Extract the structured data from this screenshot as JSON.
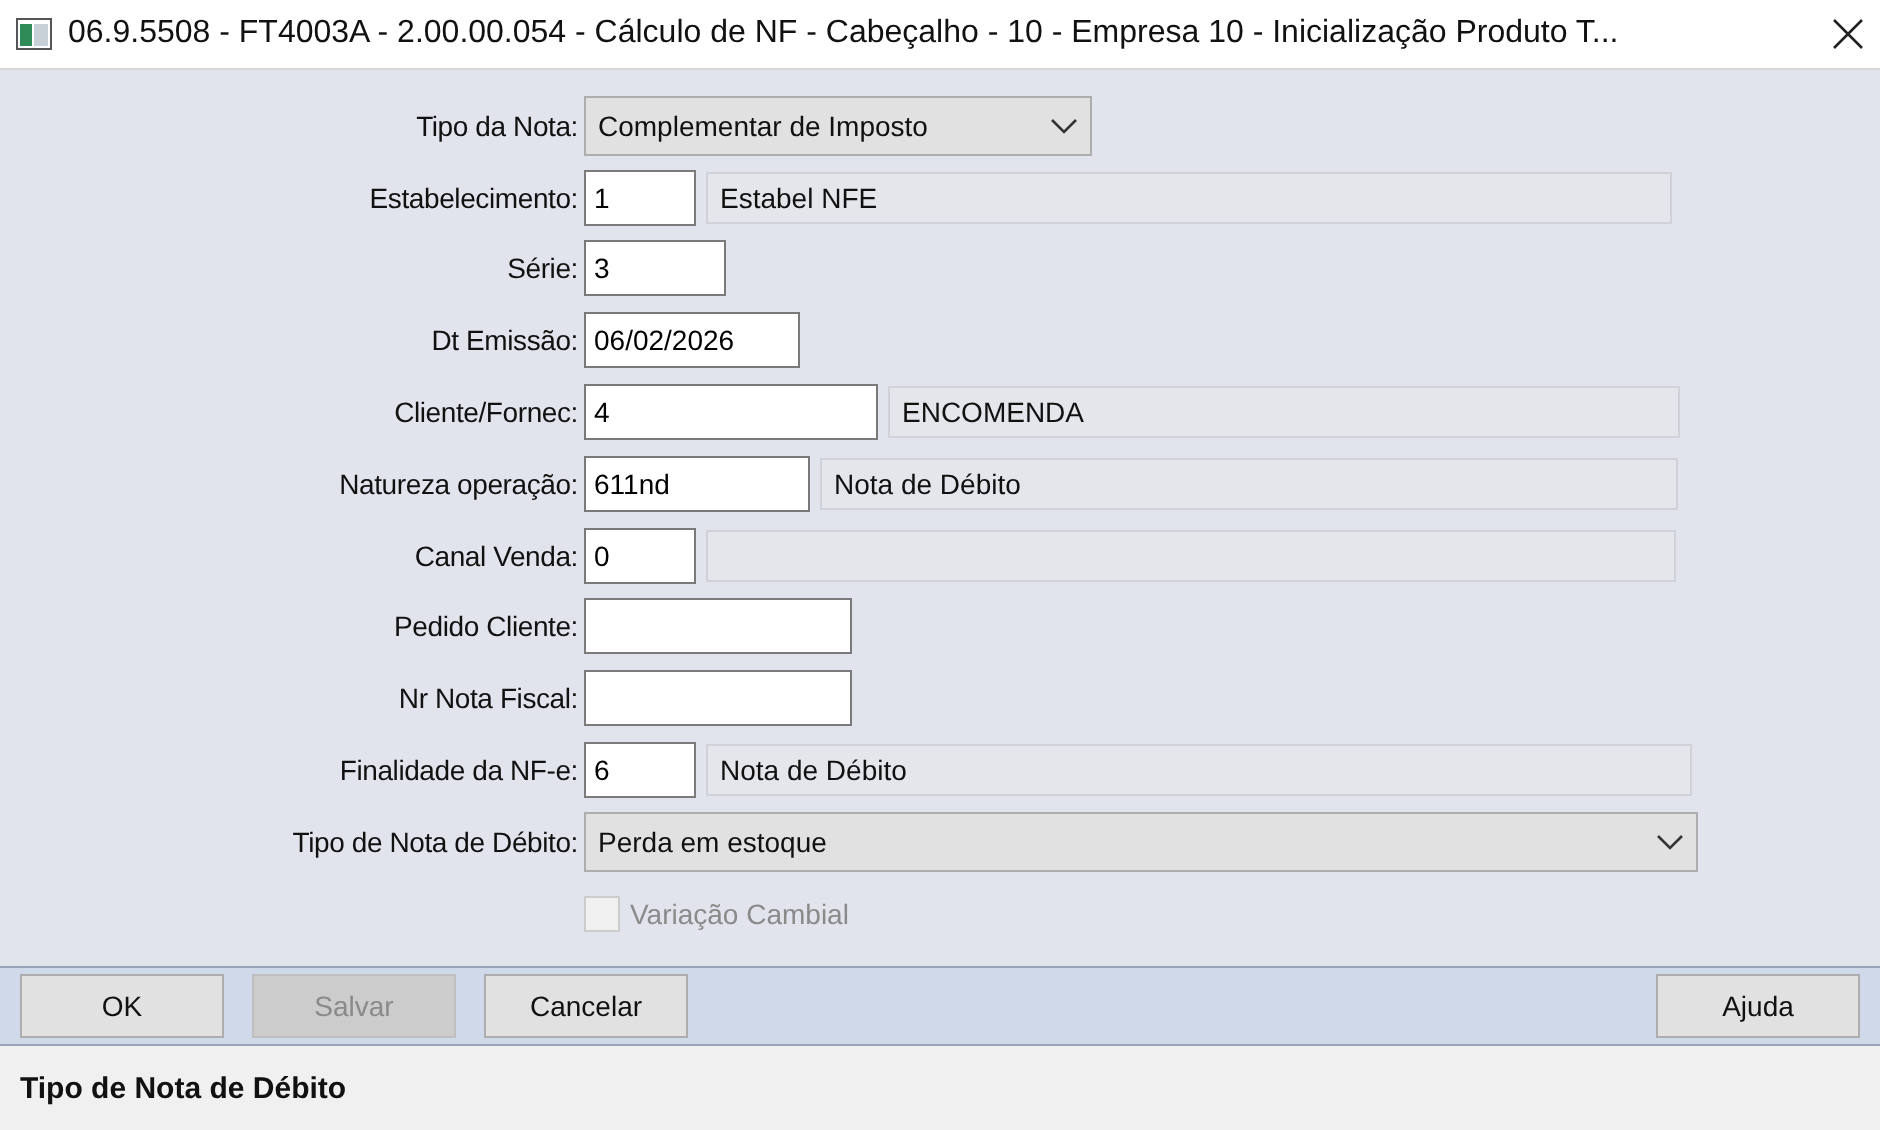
{
  "window": {
    "title": "06.9.5508 - FT4003A - 2.00.00.054 - Cálculo de NF - Cabeçalho - 10 - Empresa 10 - Inicialização Produto T..."
  },
  "form": [
    {
      "kind": "select",
      "label": "Tipo da Nota:",
      "value": "Complementar de Imposto"
    },
    {
      "kind": "field",
      "label": "Estabelecimento:",
      "value": "1",
      "description": "Estabel NFE"
    },
    {
      "kind": "field",
      "label": "Série:",
      "value": "3"
    },
    {
      "kind": "field",
      "label": "Dt Emissão:",
      "value": "06/02/2026"
    },
    {
      "kind": "field",
      "label": "Cliente/Fornec:",
      "value": "4",
      "description": "ENCOMENDA"
    },
    {
      "kind": "field",
      "label": "Natureza operação:",
      "value": "611nd",
      "description": "Nota de Débito"
    },
    {
      "kind": "lookup",
      "label": "Canal Venda:",
      "value": "0"
    },
    {
      "kind": "field",
      "label": "Pedido Cliente:"
    },
    {
      "kind": "field",
      "label": "Nr Nota Fiscal:"
    },
    {
      "kind": "field",
      "label": "Finalidade da NF-e:",
      "value": "6",
      "description": "Nota de Débito"
    },
    {
      "kind": "select",
      "label": "Tipo de Nota de Débito:",
      "value": "Perda em estoque"
    },
    {
      "kind": "checkbox",
      "label": "Variação Cambial",
      "checked": false,
      "disabled": true
    }
  ],
  "buttons": [
    {
      "label": "OK",
      "disabled": false
    },
    {
      "label": "Salvar",
      "disabled": true
    },
    {
      "label": "Cancelar",
      "disabled": false
    },
    {
      "label": "Ajuda",
      "disabled": false
    }
  ],
  "status_bar": "Tipo de Nota de Débito"
}
